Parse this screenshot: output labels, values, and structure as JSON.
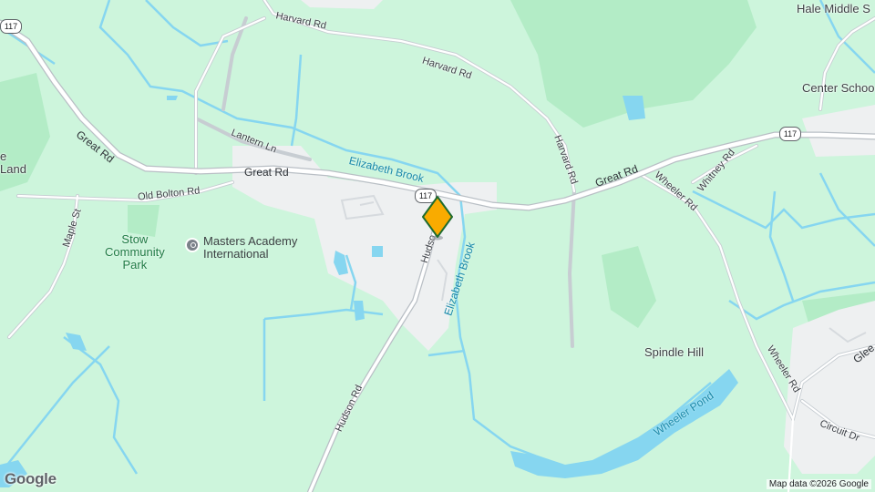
{
  "map": {
    "labels": {
      "great_rd_west": "Great Rd",
      "great_rd_center": "Great Rd",
      "great_rd_east": "Great Rd",
      "harvard_rd_top": "Harvard Rd",
      "harvard_rd_mid": "Harvard Rd",
      "harvard_rd_vertical": "Harvard Rd",
      "lantern_ln": "Lantern Ln",
      "old_bolton_rd": "Old Bolton Rd",
      "maple_st": "Maple St",
      "hudson_rd": "Hudson Rd",
      "hudson_rd_short": "Hudso",
      "wheeler_rd_north": "Wheeler Rd",
      "wheeler_rd_south": "Wheeler Rd",
      "whitney_rd": "Whitney Rd",
      "circuit_dr": "Circuit Dr",
      "glen_partial": "Glee",
      "elizabeth_brook_h": "Elizabeth Brook",
      "elizabeth_brook_v": "Elizabeth Brook",
      "wheeler_pond": "Wheeler Pond",
      "spindle_hill": "Spindle Hill",
      "stow_community_park": "Stow\nCommunity\nPark",
      "masters_academy": "Masters Academy\nInternational",
      "hale_middle": "Hale Middle S",
      "center_school": "Center Schoo",
      "land_partial": "e\nLand"
    },
    "shields": {
      "route_117_west": "117",
      "route_117_center": "117",
      "route_117_east": "117"
    },
    "marker": {
      "color": "#f9ab00",
      "border": "#1e6b2e"
    },
    "google_logo": "Google",
    "attribution": "Map data ©2026 Google"
  },
  "colors": {
    "land": "#cdf5dc",
    "forest": "#b3ecc6",
    "water": "#86d6f0",
    "urban": "#eef0f1",
    "road": "#ffffff",
    "road_outline": "#c7cdd2"
  }
}
